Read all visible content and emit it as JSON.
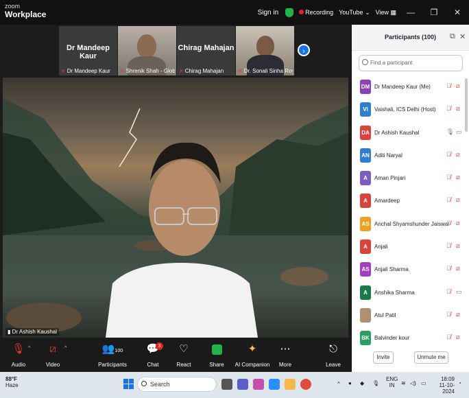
{
  "titlebar": {
    "brand_top": "zoom",
    "brand_bottom": "Workplace",
    "sign_in": "Sign in",
    "recording": "Recording",
    "youtube": "YouTube",
    "view": "View"
  },
  "thumbnails": [
    {
      "display_name": "Dr Mandeep Kaur",
      "caption": "Dr Mandeep Kaur",
      "video": false
    },
    {
      "display_name": "",
      "caption": "Shrenik Shah - Global ...",
      "video": true
    },
    {
      "display_name": "Chirag Mahajan",
      "caption": "Chirag Mahajan",
      "video": false
    },
    {
      "display_name": "",
      "caption": "Dr. Sonali Sinha Roy- ...",
      "video": true
    }
  ],
  "speaker": {
    "name": "Dr Ashish Kaushal"
  },
  "toolbar": {
    "audio": "Audio",
    "video": "Video",
    "participants": "Participants",
    "participants_count": "100",
    "chat": "Chat",
    "chat_badge": "3",
    "react": "React",
    "share": "Share",
    "ai_companion": "AI Companion",
    "more": "More",
    "leave": "Leave"
  },
  "panel": {
    "title": "Participants (100)",
    "search_placeholder": "Find a participant",
    "invite": "Invite",
    "unmute_me": "Unmute me",
    "participants": [
      {
        "initials": "DM",
        "name": "Dr Mandeep Kaur (Me)",
        "color": "#8c3fb8",
        "mic": "off",
        "cam": "off"
      },
      {
        "initials": "VI",
        "name": "Vaishali, ICS Delhi (Host)",
        "color": "#2f7fd1",
        "mic": "off",
        "cam": "off"
      },
      {
        "initials": "DA",
        "name": "Dr Ashish Kaushal",
        "color": "#d9433a",
        "mic": "on",
        "cam": "on"
      },
      {
        "initials": "AN",
        "name": "Aditi Naryal",
        "color": "#2f7fd1",
        "mic": "off",
        "cam": "off"
      },
      {
        "initials": "A",
        "name": "Aman Pinjari",
        "color": "#7d5cc4",
        "mic": "off",
        "cam": "off"
      },
      {
        "initials": "A",
        "name": "Amardeep",
        "color": "#d9433a",
        "mic": "off",
        "cam": "off"
      },
      {
        "initials": "AS",
        "name": "Anchal Shyamshunder Jaiswal",
        "color": "#f0a01e",
        "mic": "off",
        "cam": "off"
      },
      {
        "initials": "A",
        "name": "Anjali",
        "color": "#d9433a",
        "mic": "off",
        "cam": "off"
      },
      {
        "initials": "AS",
        "name": "Anjali Sharma",
        "color": "#a040c0",
        "mic": "off",
        "cam": "off"
      },
      {
        "initials": "A",
        "name": "Anshika Sharma",
        "color": "#1c7a4a",
        "mic": "off",
        "cam": "on"
      },
      {
        "initials": "",
        "name": "Atul Patil",
        "color": "#b09070",
        "mic": "off",
        "cam": "off"
      },
      {
        "initials": "BK",
        "name": "Balvinder kour",
        "color": "#2aa060",
        "mic": "off",
        "cam": "off"
      }
    ]
  },
  "taskbar": {
    "temp": "88°F",
    "weather": "Haze",
    "search": "Search",
    "lang1": "ENG",
    "lang2": "IN",
    "time": "18:09",
    "date": "11-10-2024"
  }
}
